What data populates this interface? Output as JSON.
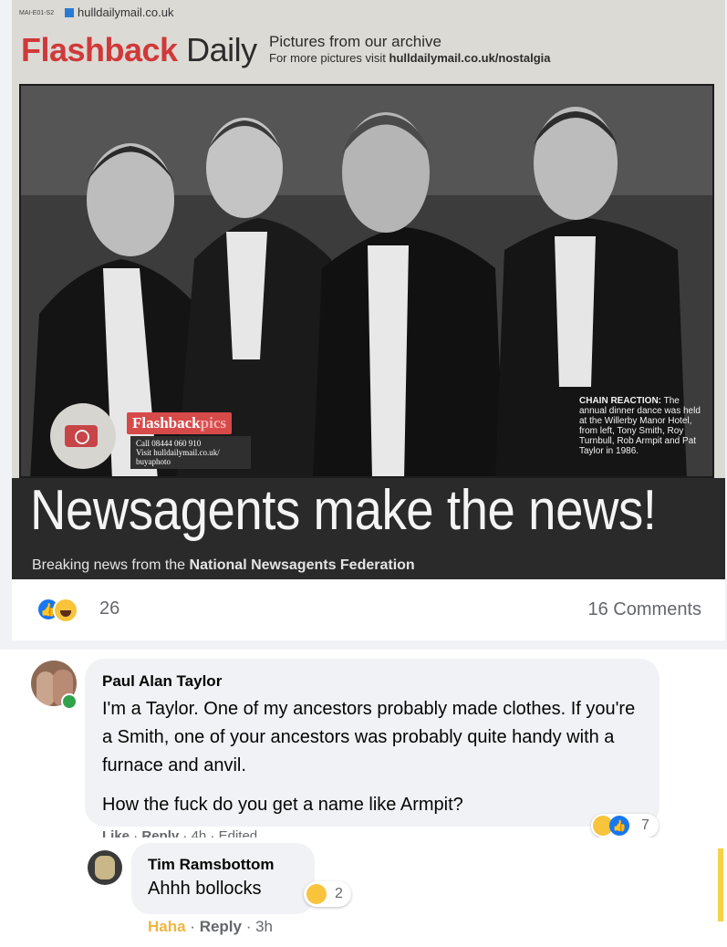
{
  "newspaper": {
    "code": "MAI-E01-S2",
    "site": "hulldailymail.co.uk",
    "brand_red": "Flashback",
    "brand_dark": "Daily",
    "pictures": "Pictures from our archive",
    "more_prefix": "For more pictures visit",
    "more_link": "hulldailymail.co.uk/nostalgia",
    "badge_title_a": "Flashback",
    "badge_title_b": "pics",
    "badge_line1": "Call 08444 060 910",
    "badge_line2": "Visit hulldailymail.co.uk/",
    "badge_line3": "buyaphoto",
    "caption_bold": "CHAIN REACTION:",
    "caption_text": "The annual dinner dance was held at the Willerby Manor Hotel, from left, Tony Smith, Roy Turnbull, Rob Armpit and Pat Taylor in 1986.",
    "headline": "Newsagents make the news!",
    "sub_prefix": "Breaking news from the",
    "sub_bold": "National Newsagents Federation"
  },
  "post": {
    "reaction_count": "26",
    "comments_label": "16 Comments"
  },
  "comment1": {
    "author": "Paul Alan Taylor",
    "text_p1": "I'm a Taylor. One of my ancestors probably made clothes. If you're a Smith, one of your ancestors was probably quite handy with a furnace and anvil.",
    "text_p2": "How the fuck do you get a name like Armpit?",
    "reaction_count": "7",
    "actions": {
      "like": "Like",
      "reply": "Reply",
      "time": "4h",
      "edited": "Edited"
    }
  },
  "comment2": {
    "author": "Tim Ramsbottom",
    "text": "Ahhh bollocks",
    "reaction_count": "2",
    "actions": {
      "haha": "Haha",
      "reply": "Reply",
      "time": "3h"
    }
  },
  "colors": {
    "facebook_blue": "#1877f2",
    "haha_yellow": "#f7c43c",
    "online_green": "#31a24c",
    "brand_red": "#d0393a"
  }
}
